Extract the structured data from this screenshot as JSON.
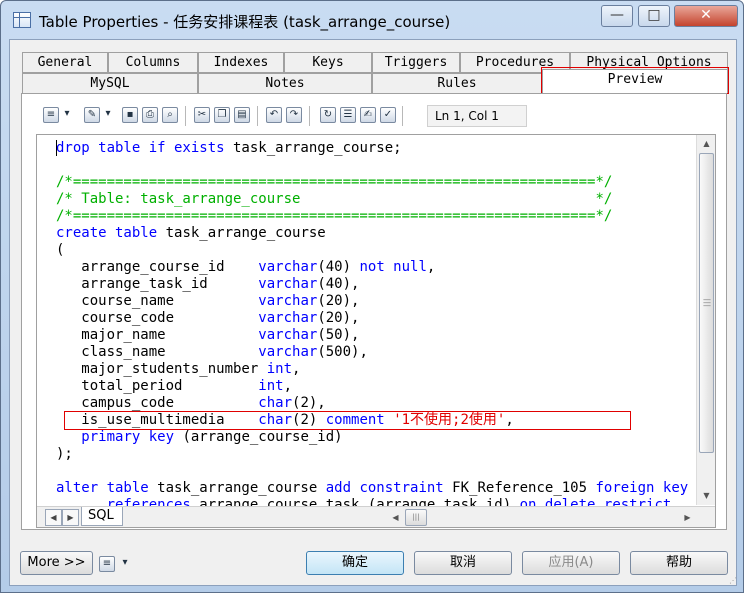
{
  "window": {
    "title": "Table Properties - 任务安排课程表 (task_arrange_course)",
    "min_glyph": "—",
    "max_glyph": "□",
    "close_glyph": "✕"
  },
  "tabs": {
    "row1": [
      "General",
      "Columns",
      "Indexes",
      "Keys",
      "Triggers",
      "Procedures",
      "Physical Options"
    ],
    "row2": [
      "MySQL",
      "Notes",
      "Rules",
      "Preview"
    ],
    "active": "Preview"
  },
  "toolbar": {
    "cursor_position": "Ln 1, Col 1"
  },
  "editor": {
    "active_tab": "SQL",
    "lines": [
      [
        {
          "t": "drop table if exists",
          "c": "kw"
        },
        {
          "t": " task_arrange_course;"
        }
      ],
      [],
      [
        {
          "t": "/*==============================================================*/",
          "c": "cm"
        }
      ],
      [
        {
          "t": "/* Table: task_arrange_course                                   */",
          "c": "cm"
        }
      ],
      [
        {
          "t": "/*==============================================================*/",
          "c": "cm"
        }
      ],
      [
        {
          "t": "create table",
          "c": "kw"
        },
        {
          "t": " task_arrange_course"
        }
      ],
      [
        {
          "t": "("
        }
      ],
      [
        {
          "t": "   arrange_course_id    "
        },
        {
          "t": "varchar",
          "c": "kw"
        },
        {
          "t": "(40) "
        },
        {
          "t": "not null",
          "c": "kw"
        },
        {
          "t": ","
        }
      ],
      [
        {
          "t": "   arrange_task_id      "
        },
        {
          "t": "varchar",
          "c": "kw"
        },
        {
          "t": "(40),"
        }
      ],
      [
        {
          "t": "   course_name          "
        },
        {
          "t": "varchar",
          "c": "kw"
        },
        {
          "t": "(20),"
        }
      ],
      [
        {
          "t": "   course_code          "
        },
        {
          "t": "varchar",
          "c": "kw"
        },
        {
          "t": "(20),"
        }
      ],
      [
        {
          "t": "   major_name           "
        },
        {
          "t": "varchar",
          "c": "kw"
        },
        {
          "t": "(50),"
        }
      ],
      [
        {
          "t": "   class_name           "
        },
        {
          "t": "varchar",
          "c": "kw"
        },
        {
          "t": "(500),"
        }
      ],
      [
        {
          "t": "   major_students_number "
        },
        {
          "t": "int",
          "c": "kw"
        },
        {
          "t": ","
        }
      ],
      [
        {
          "t": "   total_period         "
        },
        {
          "t": "int",
          "c": "kw"
        },
        {
          "t": ","
        }
      ],
      [
        {
          "t": "   campus_code          "
        },
        {
          "t": "char",
          "c": "kw"
        },
        {
          "t": "(2),"
        }
      ],
      [
        {
          "t": "   is_use_multimedia    "
        },
        {
          "t": "char",
          "c": "kw"
        },
        {
          "t": "(2) "
        },
        {
          "t": "comment",
          "c": "kw"
        },
        {
          "t": " "
        },
        {
          "t": "'1不使用;2使用'",
          "c": "str"
        },
        {
          "t": ","
        }
      ],
      [
        {
          "t": "   "
        },
        {
          "t": "primary key",
          "c": "kw"
        },
        {
          "t": " (arrange_course_id)"
        }
      ],
      [
        {
          "t": ");"
        }
      ],
      [],
      [
        {
          "t": "alter table",
          "c": "kw"
        },
        {
          "t": " task_arrange_course "
        },
        {
          "t": "add constraint",
          "c": "kw"
        },
        {
          "t": " FK_Reference_105 "
        },
        {
          "t": "foreign key",
          "c": "kw"
        }
      ],
      [
        {
          "t": "      "
        },
        {
          "t": "references",
          "c": "kw"
        },
        {
          "t": " arrange_course_task (arrange_task_id) "
        },
        {
          "t": "on delete restrict",
          "c": "kw"
        }
      ]
    ]
  },
  "buttons": {
    "more": "More >>",
    "ok": "确定",
    "cancel": "取消",
    "apply": "应用(A)",
    "help": "帮助"
  }
}
